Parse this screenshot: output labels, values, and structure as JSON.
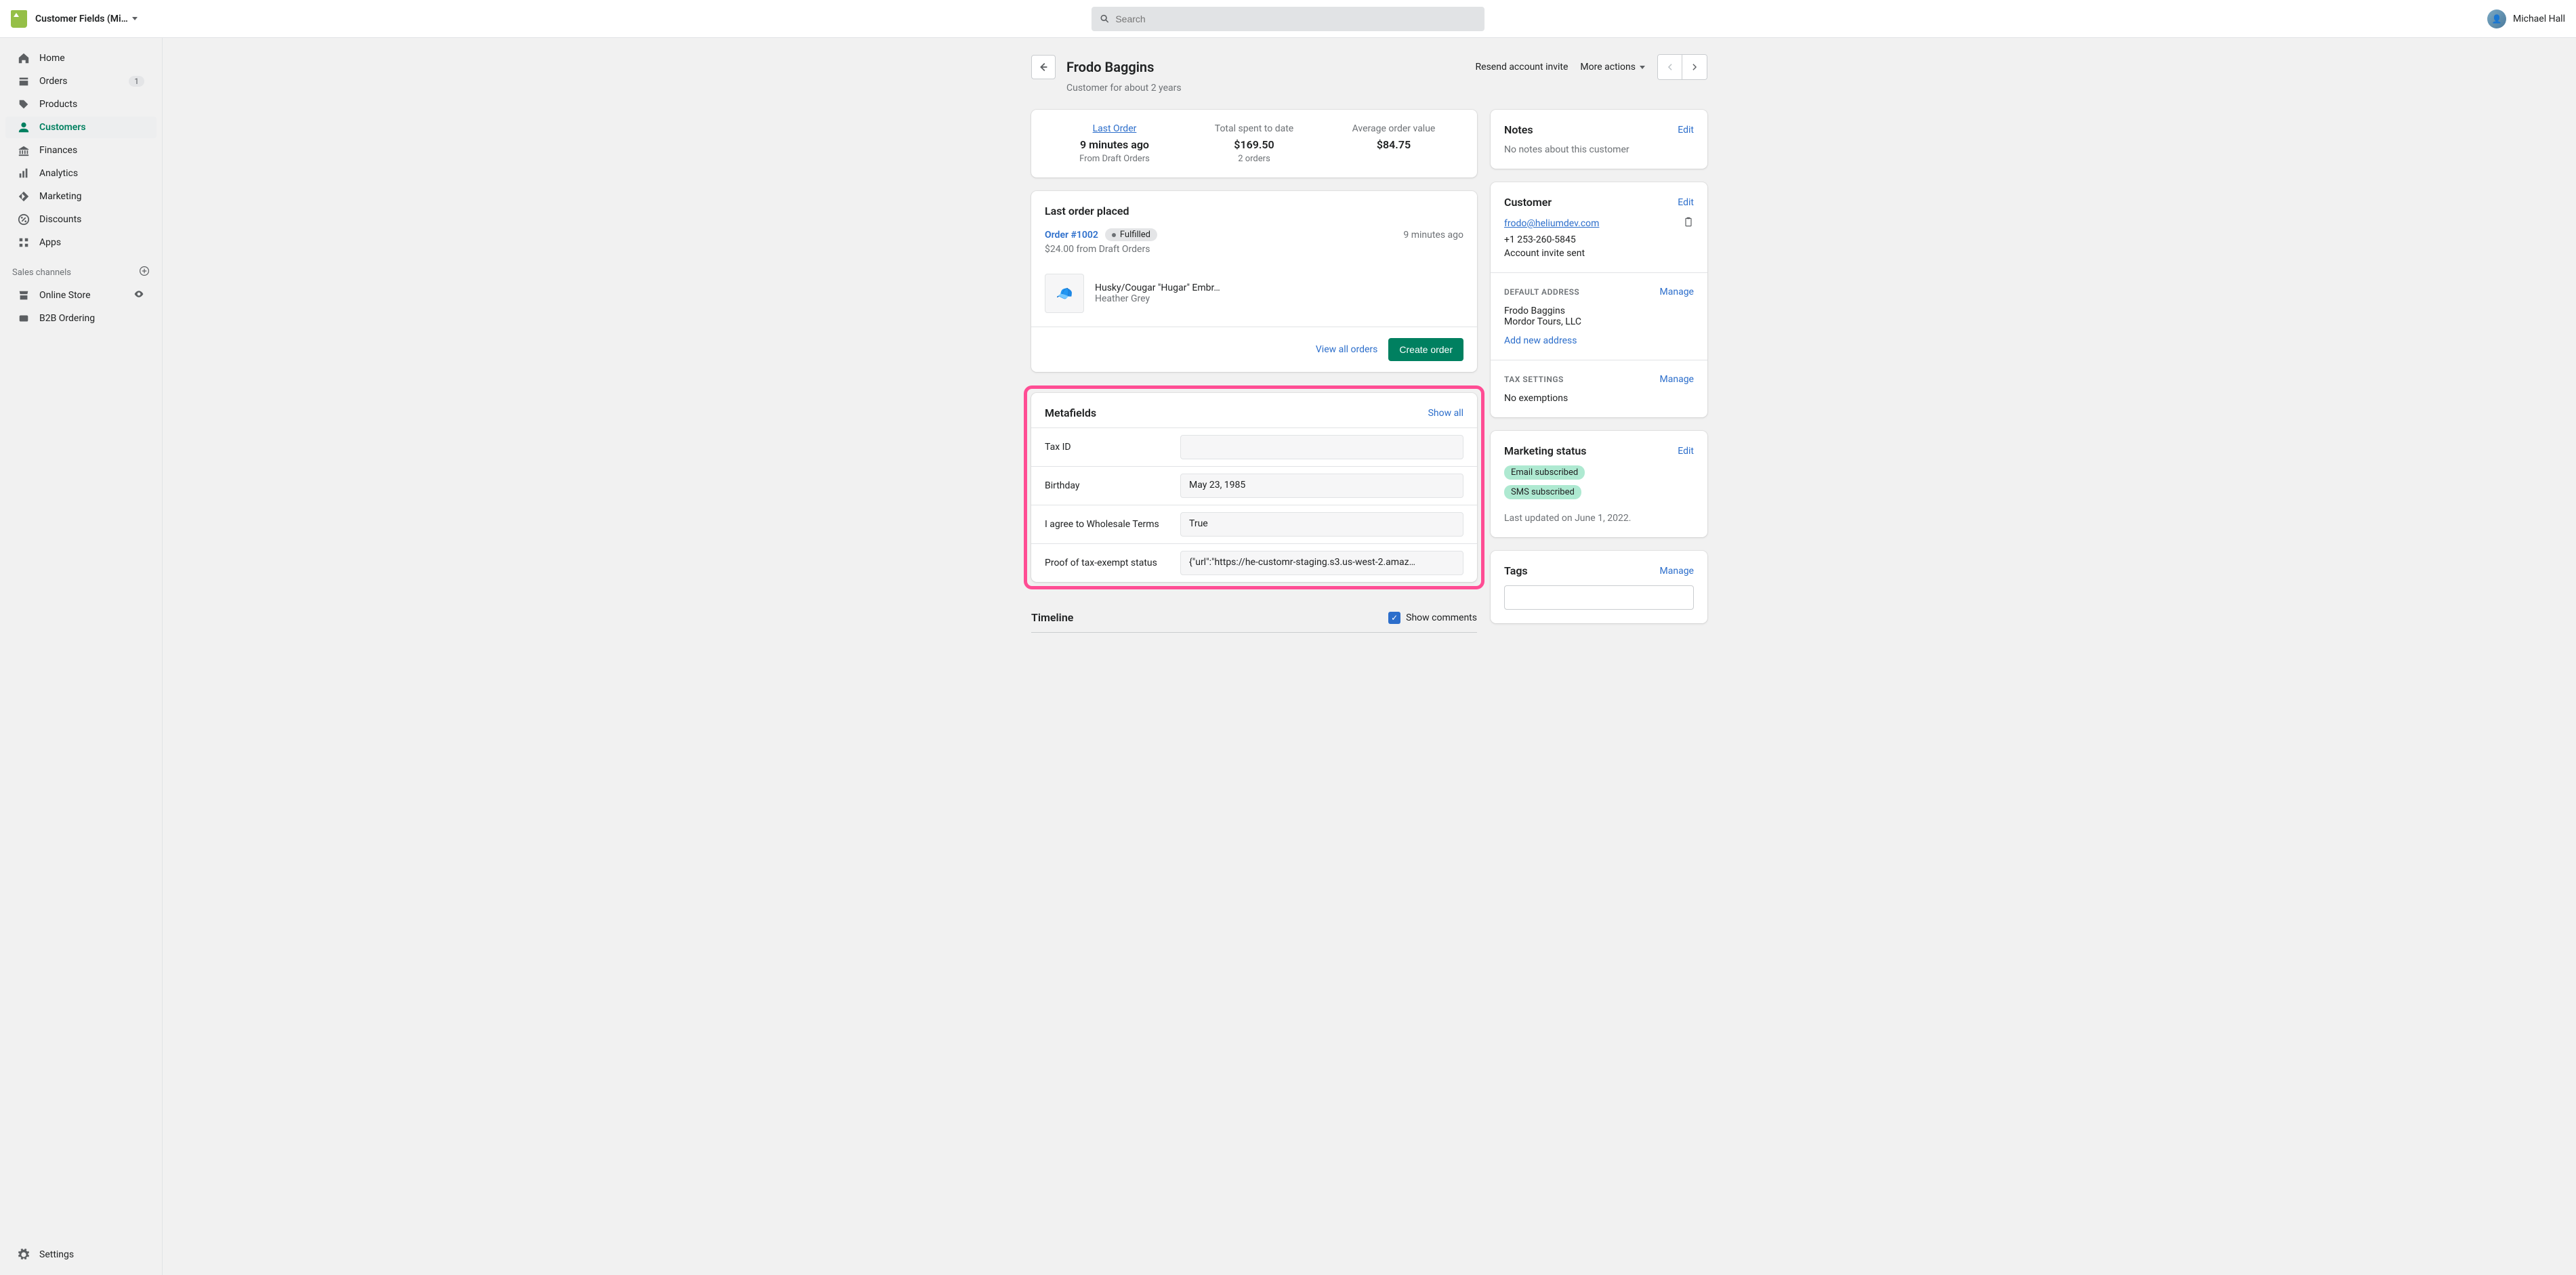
{
  "topbar": {
    "app_name": "Customer Fields (Mi…",
    "search_placeholder": "Search",
    "user_name": "Michael Hall"
  },
  "sidebar": {
    "items": [
      {
        "label": "Home",
        "icon": "home"
      },
      {
        "label": "Orders",
        "icon": "orders",
        "badge": "1"
      },
      {
        "label": "Products",
        "icon": "products"
      },
      {
        "label": "Customers",
        "icon": "customers",
        "active": true
      },
      {
        "label": "Finances",
        "icon": "finances"
      },
      {
        "label": "Analytics",
        "icon": "analytics"
      },
      {
        "label": "Marketing",
        "icon": "marketing"
      },
      {
        "label": "Discounts",
        "icon": "discounts"
      },
      {
        "label": "Apps",
        "icon": "apps"
      }
    ],
    "sales_channels_label": "Sales channels",
    "channels": [
      {
        "label": "Online Store",
        "icon": "store",
        "trailing": "eye"
      },
      {
        "label": "B2B Ordering",
        "icon": "b2b"
      }
    ],
    "settings_label": "Settings"
  },
  "page": {
    "title": "Frodo Baggins",
    "subtitle": "Customer for about 2 years",
    "resend_action": "Resend account invite",
    "more_actions": "More actions"
  },
  "stats": {
    "last_order": {
      "label": "Last Order",
      "value": "9 minutes ago",
      "sub": "From Draft Orders"
    },
    "total_spent": {
      "label": "Total spent to date",
      "value": "$169.50",
      "sub": "2 orders"
    },
    "avg_value": {
      "label": "Average order value",
      "value": "$84.75"
    }
  },
  "last_order_card": {
    "title": "Last order placed",
    "order_number": "Order #1002",
    "status": "Fulfilled",
    "time": "9 minutes ago",
    "sub": "$24.00 from Draft Orders",
    "product_name": "Husky/Cougar \"Hugar\" Embr…",
    "product_variant": "Heather Grey",
    "view_all": "View all orders",
    "create_order": "Create order"
  },
  "metafields": {
    "title": "Metafields",
    "show_all": "Show all",
    "rows": [
      {
        "label": "Tax ID",
        "value": ""
      },
      {
        "label": "Birthday",
        "value": "May 23, 1985"
      },
      {
        "label": "I agree to Wholesale Terms",
        "value": "True"
      },
      {
        "label": "Proof of tax-exempt status",
        "value": "{\"url\":\"https://he-customr-staging.s3.us-west-2.amaz…"
      }
    ]
  },
  "timeline": {
    "title": "Timeline",
    "show_comments": "Show comments"
  },
  "notes": {
    "title": "Notes",
    "edit": "Edit",
    "empty": "No notes about this customer"
  },
  "customer_card": {
    "title": "Customer",
    "edit": "Edit",
    "email": "frodo@heliumdev.com",
    "phone": "+1 253-260-5845",
    "invite_status": "Account invite sent"
  },
  "default_address": {
    "label": "DEFAULT ADDRESS",
    "manage": "Manage",
    "line1": "Frodo Baggins",
    "line2": "Mordor Tours, LLC",
    "add_new": "Add new address"
  },
  "tax_settings": {
    "label": "TAX SETTINGS",
    "manage": "Manage",
    "text": "No exemptions"
  },
  "marketing_status": {
    "title": "Marketing status",
    "edit": "Edit",
    "pills": [
      "Email subscribed",
      "SMS subscribed"
    ],
    "updated": "Last updated on June 1, 2022."
  },
  "tags": {
    "title": "Tags",
    "manage": "Manage"
  }
}
